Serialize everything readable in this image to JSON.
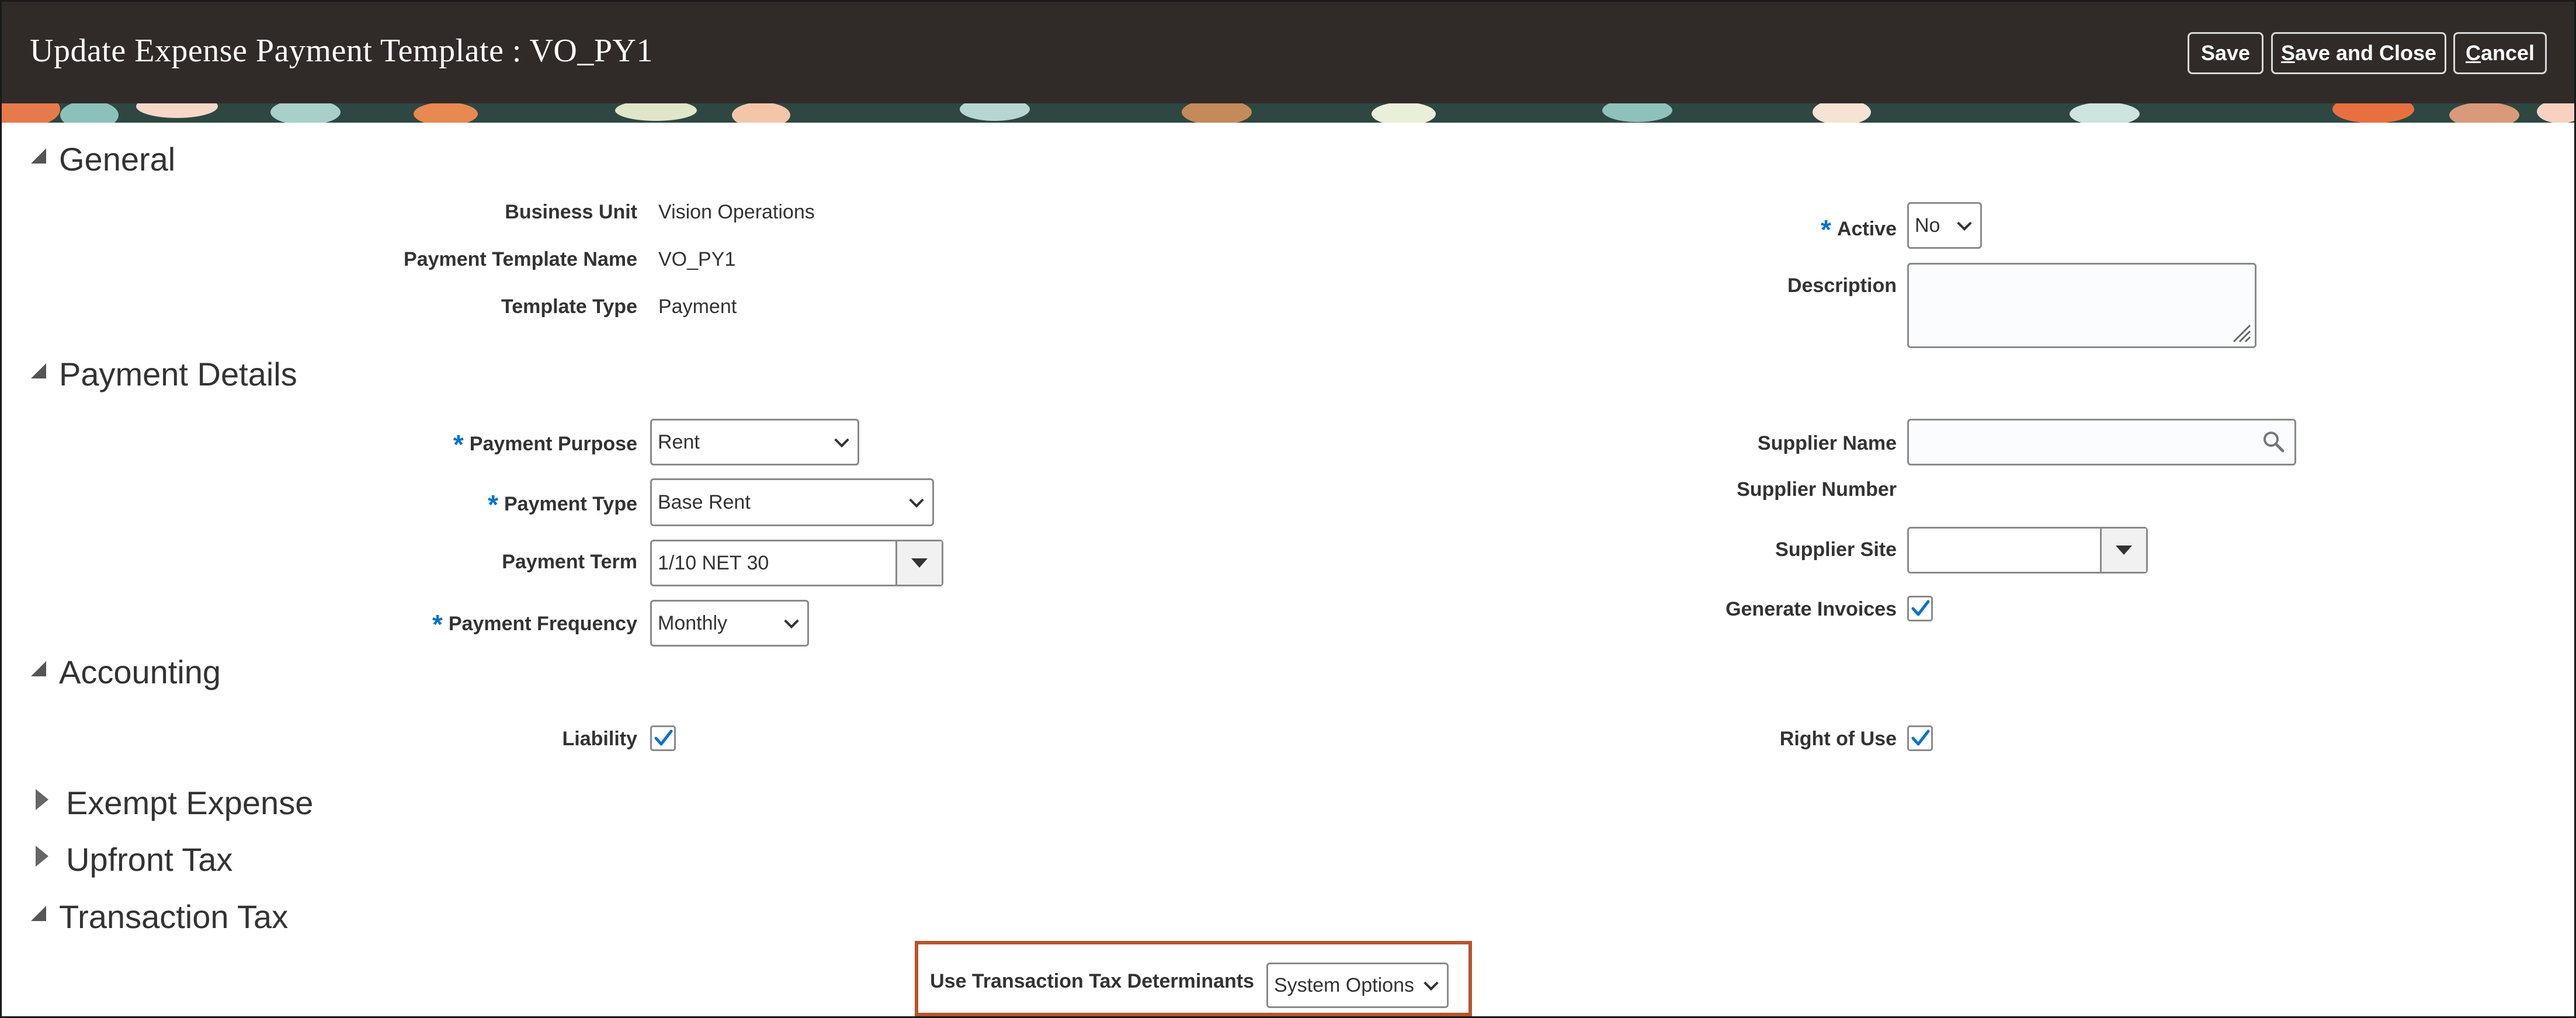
{
  "header": {
    "title": "Update Expense Payment Template : VO_PY1",
    "buttons": [
      {
        "key": "save",
        "prefix": "",
        "mnemonic": "",
        "suffix": "Save"
      },
      {
        "key": "save_close",
        "prefix": "",
        "mnemonic": "S",
        "suffix": "ave and Close"
      },
      {
        "key": "cancel",
        "prefix": "",
        "mnemonic": "C",
        "suffix": "ancel"
      }
    ]
  },
  "sections": {
    "general": "General",
    "payment_details": "Payment Details",
    "accounting": "Accounting",
    "exempt_expense": "Exempt Expense",
    "upfront_tax": "Upfront Tax",
    "transaction_tax": "Transaction Tax"
  },
  "general": {
    "business_unit_label": "Business Unit",
    "business_unit_value": "Vision Operations",
    "template_name_label": "Payment Template Name",
    "template_name_value": "VO_PY1",
    "template_type_label": "Template Type",
    "template_type_value": "Payment",
    "active_label": "Active",
    "active_value": "No",
    "description_label": "Description",
    "description_value": ""
  },
  "payment_details": {
    "purpose_label": "Payment Purpose",
    "purpose_value": "Rent",
    "type_label": "Payment Type",
    "type_value": "Base Rent",
    "term_label": "Payment Term",
    "term_value": "1/10 NET 30",
    "frequency_label": "Payment Frequency",
    "frequency_value": "Monthly",
    "supplier_name_label": "Supplier Name",
    "supplier_name_value": "",
    "supplier_number_label": "Supplier Number",
    "supplier_site_label": "Supplier Site",
    "supplier_site_value": "",
    "generate_invoices_label": "Generate Invoices",
    "generate_invoices_checked": true
  },
  "accounting": {
    "liability_label": "Liability",
    "liability_checked": true,
    "right_of_use_label": "Right of Use",
    "right_of_use_checked": true
  },
  "transaction_tax": {
    "determinants_label": "Use Transaction Tax Determinants",
    "determinants_value": "System Options"
  },
  "colors": {
    "header_bg": "#302b29",
    "required_star": "#0572ce",
    "checkmark": "#0572ce",
    "highlight_border": "#b8552a"
  },
  "icons": [
    "search-icon",
    "checkmark-icon",
    "chevron-down-icon",
    "dropdown-arrow-icon",
    "expand-triangle-icon",
    "collapse-triangle-icon"
  ]
}
